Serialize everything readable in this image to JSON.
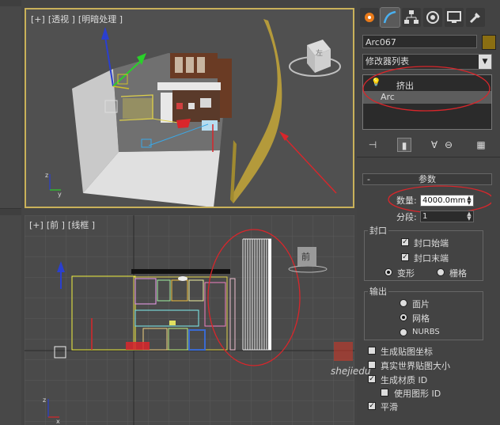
{
  "viewport_top": {
    "label_plus": "[+]",
    "label_view": "[透视 ]",
    "label_shading": "[明暗处理 ]",
    "cube_text": "左"
  },
  "viewport_bottom": {
    "label_plus": "[+]",
    "label_view": "[前 ]",
    "label_shading": "[线框 ]",
    "cube_text": "前"
  },
  "panel": {
    "object_name": "Arc067",
    "object_color": "#8a6e12",
    "modifier_list": "修改器列表",
    "stack_items": [
      "挤出",
      "Arc"
    ],
    "params_title": "参数",
    "params_collapse": "-",
    "amount_label": "数量:",
    "amount_value": "4000.0mm",
    "segments_label": "分段:",
    "segments_value": "1",
    "cap_group": "封口",
    "cap_start": "封口始端",
    "cap_end": "封口末端",
    "morph": "变形",
    "grid": "栅格",
    "output_group": "输出",
    "patch": "面片",
    "mesh": "网格",
    "nurbs": "NURBS",
    "gen_mapping": "生成贴图坐标",
    "real_world": "真实世界贴图大小",
    "gen_matid": "生成材质 ID",
    "use_shape_id": "使用图形 ID",
    "smooth": "平滑"
  },
  "watermark": {
    "text": "shejiedu"
  },
  "colors": {
    "annotation_red": "#d9262b",
    "viewport_active_border": "#c9b15a"
  }
}
